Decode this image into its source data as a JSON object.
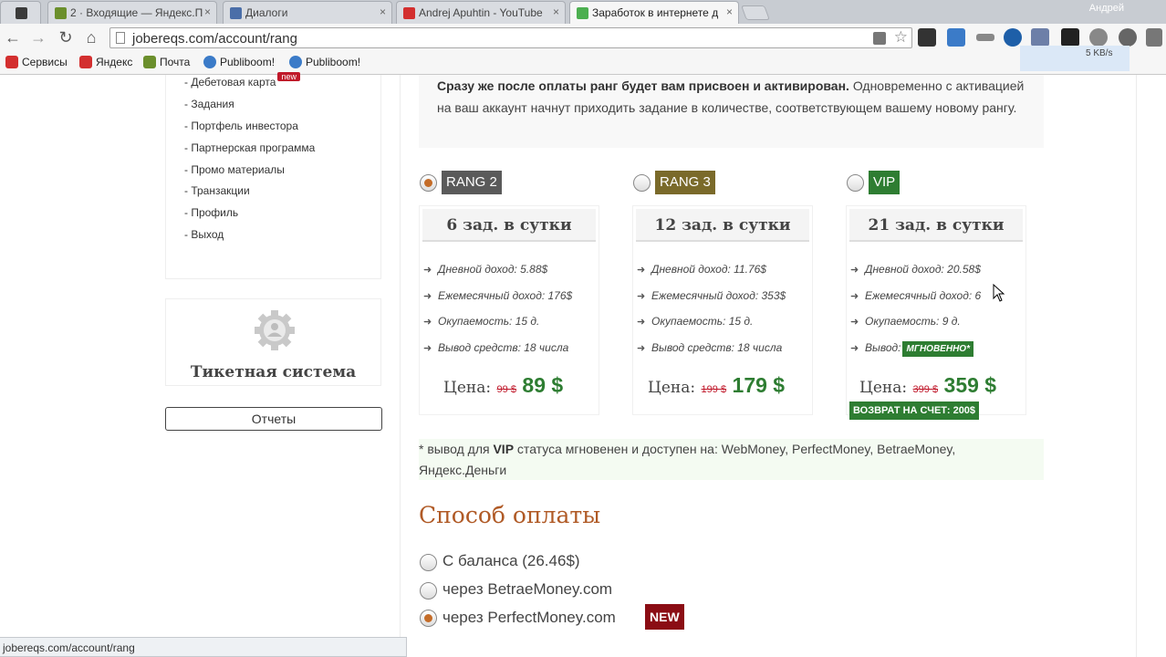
{
  "browser": {
    "tabs": [
      {
        "title": "",
        "icon_color": "#3b3b3b"
      },
      {
        "title": "2 · Входящие — Яндекс.П",
        "icon_color": "#6b8f2c"
      },
      {
        "title": "Диалоги",
        "icon_color": "#4a6ea8"
      },
      {
        "title": "Andrej Apuhtin - YouTube",
        "icon_color": "#d32f2f"
      },
      {
        "title": "Заработок в интернете д",
        "icon_color": "#4caf50"
      }
    ],
    "close_glyph": "×",
    "user": "Андрей",
    "url": "jobereqs.com/account/rang",
    "speed": "5 KB/s",
    "bookmarks": [
      {
        "label": "Сервисы",
        "icon_color": "#d32f2f"
      },
      {
        "label": "Яндекс",
        "icon_color": "#d32f2f"
      },
      {
        "label": "Почта",
        "icon_color": "#6b8f2c"
      },
      {
        "label": "Publiboom!",
        "icon_color": "#3b7bc8"
      },
      {
        "label": "Publiboom!",
        "icon_color": "#3b7bc8"
      }
    ]
  },
  "sidebar": {
    "menu": [
      {
        "label": "- Дебетовая карта",
        "badge": "new"
      },
      {
        "label": "- Задания"
      },
      {
        "label": "- Портфель инвестора"
      },
      {
        "label": "- Партнерская программа"
      },
      {
        "label": "- Промо материалы"
      },
      {
        "label": "- Транзакции"
      },
      {
        "label": "- Профиль"
      },
      {
        "label": "- Выход"
      }
    ],
    "ticket_title": "Тикетная система",
    "reports_label": "Отчеты"
  },
  "info": {
    "bold": "Сразу же после оплаты ранг будет вам присвоен и активирован.",
    "text": " Одновременно с активацией на ваш аккаунт начнут приходить задание в количестве, соответствующем вашему новому рангу."
  },
  "plans": [
    {
      "label": "RANG 2",
      "label_color": "#5a5a5a",
      "checked": true,
      "tasks": "6 зад. в сутки",
      "rows": [
        "Дневной доход: 5.88$",
        "Ежемесячный доход: 176$",
        "Окупаемость: 15 д.",
        "Вывод средств: 18 числа"
      ],
      "price_label": "Цена:",
      "price_old": "99 $",
      "price_new": "89 $"
    },
    {
      "label": "RANG 3",
      "label_color": "#7a6a2a",
      "checked": false,
      "tasks": "12 зад. в сутки",
      "rows": [
        "Дневной доход: 11.76$",
        "Ежемесячный доход: 353$",
        "Окупаемость: 15 д.",
        "Вывод средств: 18 числа"
      ],
      "price_label": "Цена:",
      "price_old": "199 $",
      "price_new": "179 $"
    },
    {
      "label": "VIP",
      "label_color": "#2e7d32",
      "checked": false,
      "tasks": "21 зад. в сутки",
      "rows": [
        "Дневной доход: 20.58$",
        "Ежемесячный доход: 6",
        "Окупаемость: 9 д.",
        "Вывод:"
      ],
      "instant": "МГНОВЕННО*",
      "price_label": "Цена:",
      "price_old": "399 $",
      "price_new": "359 $",
      "refund": "ВОЗВРАТ НА СЧЕТ: 200$"
    }
  ],
  "note": {
    "prefix": "* вывод для ",
    "bold": "VIP",
    "rest": " статуса мгновенен и доступен на: WebMoney, PerfectMoney, BetraeMoney, Яндекс.Деньги"
  },
  "payment": {
    "title": "Способ оплаты",
    "options": [
      {
        "label": "С баланса (26.46$)",
        "checked": false
      },
      {
        "label": "через BetraeMoney.com",
        "checked": false
      },
      {
        "label": "через PerfectMoney.com",
        "checked": true
      }
    ],
    "new_badge": "NEW"
  },
  "status_bar": "jobereqs.com/account/rang",
  "colors": {
    "accent": "#b05a26",
    "green": "#2e7d32",
    "red": "#c0182a"
  }
}
